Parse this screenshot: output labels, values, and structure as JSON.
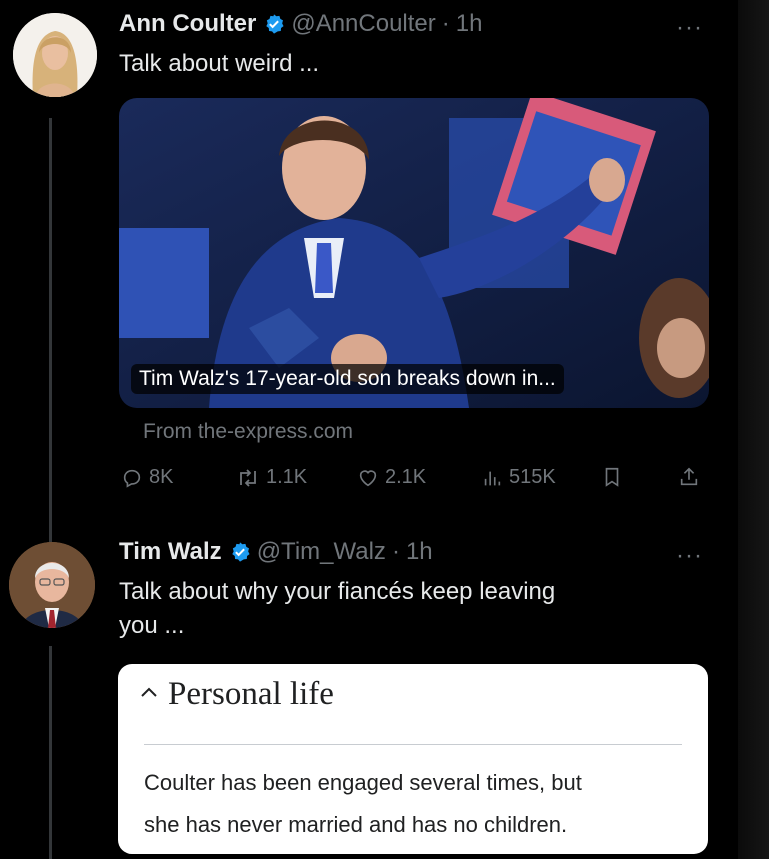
{
  "tweets": [
    {
      "name": "Ann Coulter",
      "handle": "@AnnCoulter",
      "separator": "·",
      "time": "1h",
      "text": "Talk about weird ...",
      "more": "···",
      "card": {
        "caption": "Tim Walz's 17-year-old son breaks down in...",
        "source": "From the-express.com"
      },
      "actions": {
        "replies": "8K",
        "reposts": "1.1K",
        "likes": "2.1K",
        "views": "515K"
      }
    },
    {
      "name": "Tim Walz",
      "handle": "@Tim_Walz",
      "separator": "·",
      "time": "1h",
      "text_line1": "Talk about why your fiancés keep leaving",
      "text_line2": "you ...",
      "more": "···",
      "wiki": {
        "title": "Personal life",
        "body_line1": "Coulter has been engaged several times, but",
        "body_line2": "she has never married and has no children."
      }
    }
  ],
  "colors": {
    "background": "#000000",
    "text": "#e7e9ea",
    "muted": "#71767b",
    "verified": "#1d9bf0",
    "thread_line": "#333639"
  },
  "icons": [
    "verified-badge-icon",
    "reply-icon",
    "repost-icon",
    "like-icon",
    "views-icon",
    "bookmark-icon",
    "share-icon",
    "chevron-up-icon"
  ]
}
